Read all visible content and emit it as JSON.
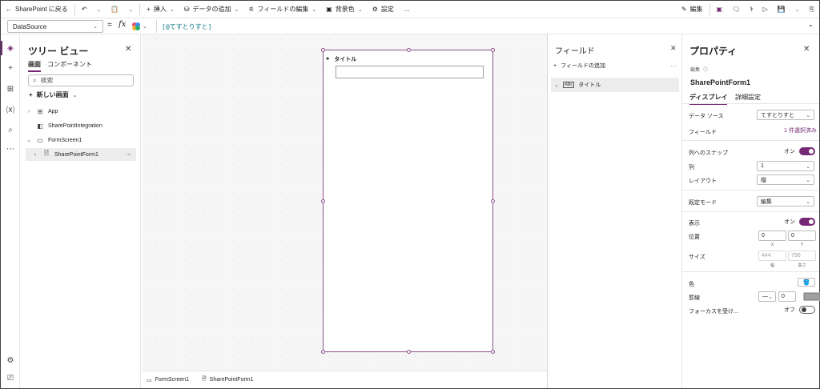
{
  "commandbar": {
    "back_label": "SharePoint に戻る",
    "insert_label": "挿入",
    "add_data_label": "データの追加",
    "edit_fields_label": "フィールドの編集",
    "background_label": "背景色",
    "settings_label": "設定",
    "more_label": "…",
    "edit_label": "編集"
  },
  "formulabar": {
    "property": "DataSource",
    "equals": "=",
    "fx": "fx",
    "formula": "[@てすとりすと]"
  },
  "treeview": {
    "title": "ツリー ビュー",
    "tab_screens": "画面",
    "tab_components": "コンポーネント",
    "search_placeholder": "検索",
    "new_screen_label": "新しい画面",
    "items": [
      {
        "label": "App"
      },
      {
        "label": "SharePointIntegration"
      },
      {
        "label": "FormScreen1"
      },
      {
        "label": "SharePointForm1"
      }
    ]
  },
  "canvas": {
    "card_label": "タイトル"
  },
  "bottombar": {
    "screen_label": "FormScreen1",
    "form_label": "SharePointForm1"
  },
  "fields": {
    "title": "フィールド",
    "add_label": "フィールドの追加",
    "field_item": "タイトル"
  },
  "properties": {
    "title": "プロパティ",
    "edit_small": "編集",
    "form_name": "SharePointForm1",
    "tab_display": "ディスプレイ",
    "tab_advanced": "詳細設定",
    "datasource_label": "データ ソース",
    "datasource_value": "てすとりすと",
    "fields_label": "フィールド",
    "fields_value": "1 件選択済み",
    "snap_label": "列へのスナップ",
    "snap_state": "オン",
    "columns_label": "列",
    "columns_value": "1",
    "layout_label": "レイアウト",
    "layout_value": "縦",
    "default_mode_label": "既定モード",
    "default_mode_value": "編集",
    "visible_label": "表示",
    "visible_state": "オン",
    "position_label": "位置",
    "pos_x": "0",
    "pos_y": "0",
    "x_label": "X",
    "y_label": "Y",
    "size_label": "サイズ",
    "width_value": "444",
    "height_value": "790",
    "width_label": "幅",
    "height_label": "高さ",
    "color_label": "色",
    "border_label": "罫線",
    "border_style": "—",
    "border_width": "0",
    "focus_label": "フォーカスを受け...",
    "focus_state": "オフ"
  },
  "colors": {
    "accent": "#742774",
    "canvas_bg": "#f6f6f6"
  }
}
